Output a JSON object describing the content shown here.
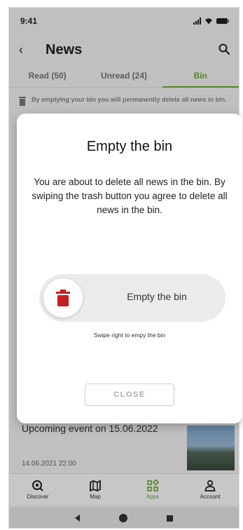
{
  "status_bar": {
    "time": "9:41"
  },
  "header": {
    "title": "News"
  },
  "tabs": [
    {
      "label": "Read (50)"
    },
    {
      "label": "Unread (24)"
    },
    {
      "label": "Bin"
    }
  ],
  "bin_notice": {
    "text": "By emptying your bin you will permanently delete all news in bin."
  },
  "news_item": {
    "title": "Upcoming event on 15.06.2022",
    "date": "14.06.2021 22:00"
  },
  "bottom_nav": [
    {
      "label": "Discover",
      "icon": "discover-icon"
    },
    {
      "label": "Map",
      "icon": "map-icon"
    },
    {
      "label": "Apps",
      "icon": "apps-icon"
    },
    {
      "label": "Account",
      "icon": "account-icon"
    }
  ],
  "modal": {
    "title": "Empty the bin",
    "body": "You are about to delete all news in the bin. By swiping the trash button you agree to delete all news in the bin.",
    "swipe_label": "Empty the bin",
    "swipe_hint": "Swipe right to empy the bin",
    "close_label": "CLOSE"
  },
  "colors": {
    "accent": "#6aaa2c",
    "danger": "#c81e1e"
  }
}
